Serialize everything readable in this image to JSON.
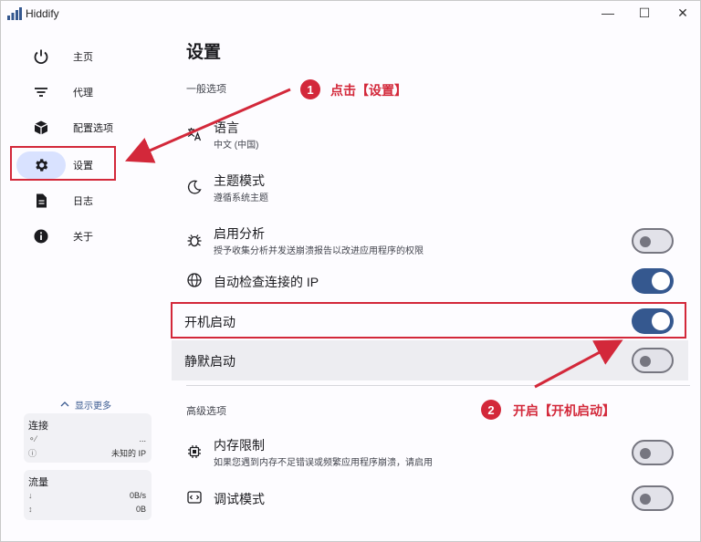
{
  "window": {
    "title": "Hiddify",
    "minimize": "—",
    "maximize": "☐",
    "close": "✕"
  },
  "sidebar": {
    "items": [
      {
        "label": "主页",
        "icon": "power-icon"
      },
      {
        "label": "代理",
        "icon": "filter-list-icon"
      },
      {
        "label": "配置选项",
        "icon": "cube-icon"
      },
      {
        "label": "设置",
        "icon": "gear-icon",
        "active": true
      },
      {
        "label": "日志",
        "icon": "document-icon"
      },
      {
        "label": "关于",
        "icon": "info-icon"
      }
    ],
    "show_more": "显示更多",
    "connection": {
      "title": "连接",
      "row1_value": "...",
      "row2_value": "未知的 IP"
    },
    "traffic": {
      "title": "流量",
      "down": "0B/s",
      "total": "0B"
    }
  },
  "main": {
    "title": "设置",
    "general_section": "一般选项",
    "advanced_section": "高级选项",
    "settings": {
      "language": {
        "title": "语言",
        "subtitle": "中文 (中国)"
      },
      "theme": {
        "title": "主题模式",
        "subtitle": "遵循系统主题"
      },
      "analytics": {
        "title": "启用分析",
        "subtitle": "授予收集分析并发送崩溃报告以改进应用程序的权限",
        "on": false
      },
      "auto_check_ip": {
        "title": "自动检查连接的 IP",
        "on": true
      },
      "launch_at_startup": {
        "title": "开机启动",
        "on": true
      },
      "silent_start": {
        "title": "静默启动",
        "on": false
      },
      "memory_limit": {
        "title": "内存限制",
        "subtitle": "如果您遇到内存不足错误或频繁应用程序崩溃，请启用",
        "on": false
      },
      "debug_mode": {
        "title": "调试模式",
        "on": false
      }
    }
  },
  "annotations": {
    "step1_num": "1",
    "step1_text": "点击【设置】",
    "step2_num": "2",
    "step2_text": "开启【开机启动】",
    "color": "#d3283a"
  },
  "colors": {
    "accent": "#35588f",
    "active_pill": "#d9e2ff"
  }
}
